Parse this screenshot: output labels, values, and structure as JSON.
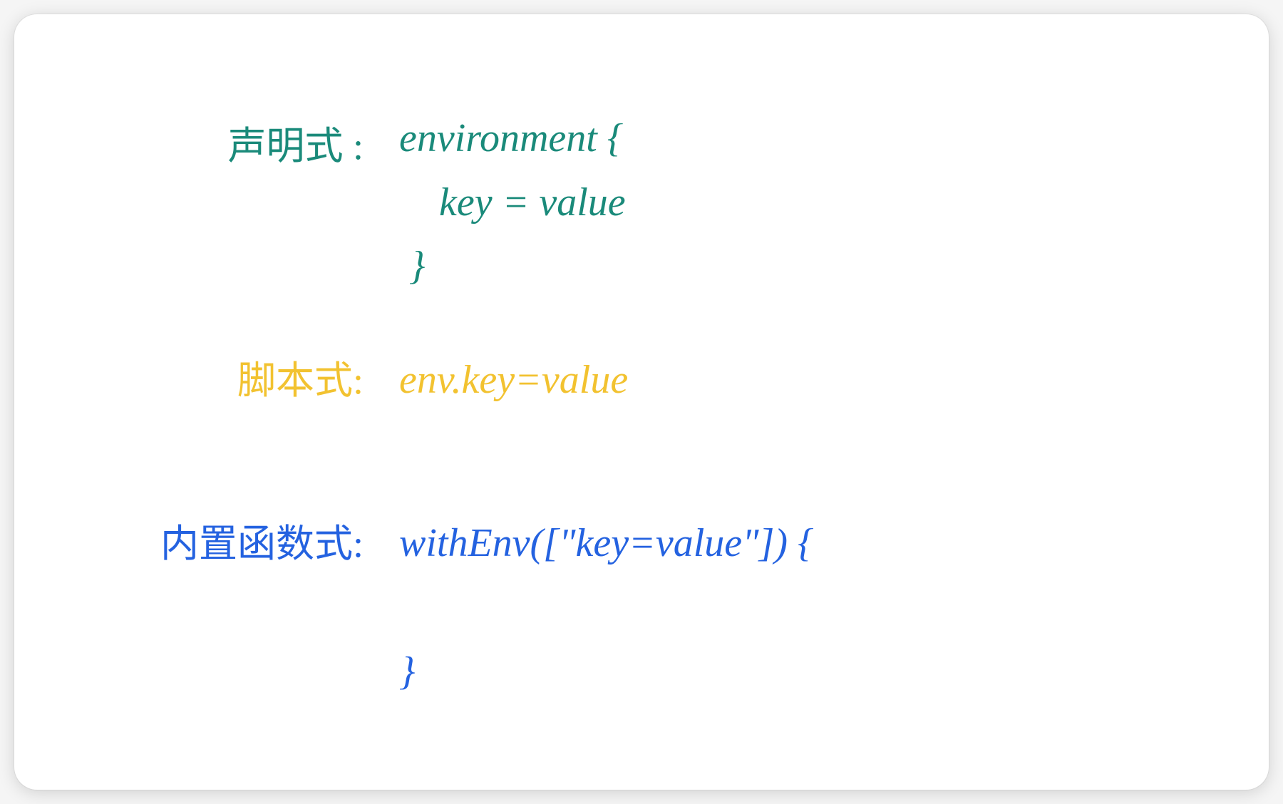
{
  "sections": {
    "declarative": {
      "label": "声明式 :",
      "code": "environment {\n    key = value\n }"
    },
    "scripted": {
      "label": "脚本式:",
      "code": "env.key=value"
    },
    "builtin": {
      "label": "内置函数式:",
      "code": "withEnv([\"key=value\"]) {\n\n}"
    }
  },
  "colors": {
    "teal": "#1a8a7a",
    "gold": "#f2c230",
    "blue": "#2462e0"
  }
}
